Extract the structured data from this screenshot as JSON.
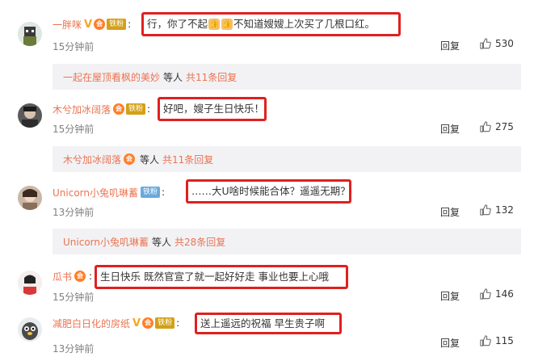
{
  "comments": [
    {
      "username": "一胖咪",
      "badges": {
        "verified": "V",
        "member": "会",
        "fan": "铁粉",
        "fan_color": "gold"
      },
      "text_parts": [
        "行，你了不起",
        "👍",
        "👍",
        "不知道嫂嫂上次买了几根口红。"
      ],
      "time": "15分钟前",
      "reply_label": "回复",
      "likes": "530",
      "sub_reply": {
        "name": "一起在屋顶看枫的美妙",
        "mid": "等人",
        "count": "共11条回复"
      }
    },
    {
      "username": "木兮加冰阔落",
      "badges": {
        "verified": "",
        "member": "会",
        "fan": "铁粉",
        "fan_color": "gold"
      },
      "text": "好吧，嫂子生日快乐！",
      "time": "15分钟前",
      "reply_label": "回复",
      "likes": "275",
      "sub_reply": {
        "name": "木兮加冰阔落",
        "mid": "等人",
        "count": "共11条回复"
      }
    },
    {
      "username": "Unicorn小兔叽琳蓄",
      "badges": {
        "verified": "",
        "member": "",
        "fan": "铁粉",
        "fan_color": "blue"
      },
      "text": "……大U啥时候能合体？遥遥无期？",
      "time": "13分钟前",
      "reply_label": "回复",
      "likes": "132",
      "sub_reply": {
        "name": "Unicorn小兔叽琳蓄",
        "mid": "等人",
        "count": "共28条回复"
      }
    },
    {
      "username": "瓜书",
      "badges": {
        "verified": "",
        "member": "会",
        "fan": "",
        "fan_color": ""
      },
      "text": "生日快乐 既然官宣了就一起好好走 事业也要上心哦",
      "time": "15分钟前",
      "reply_label": "回复",
      "likes": "146"
    },
    {
      "username": "减肥白日化的房纸",
      "badges": {
        "verified": "V",
        "member": "会",
        "fan": "铁粉",
        "fan_color": "gold"
      },
      "text": "送上遥远的祝福 早生贵子啊",
      "time": "13分钟前",
      "reply_label": "回复",
      "likes": "115"
    }
  ]
}
